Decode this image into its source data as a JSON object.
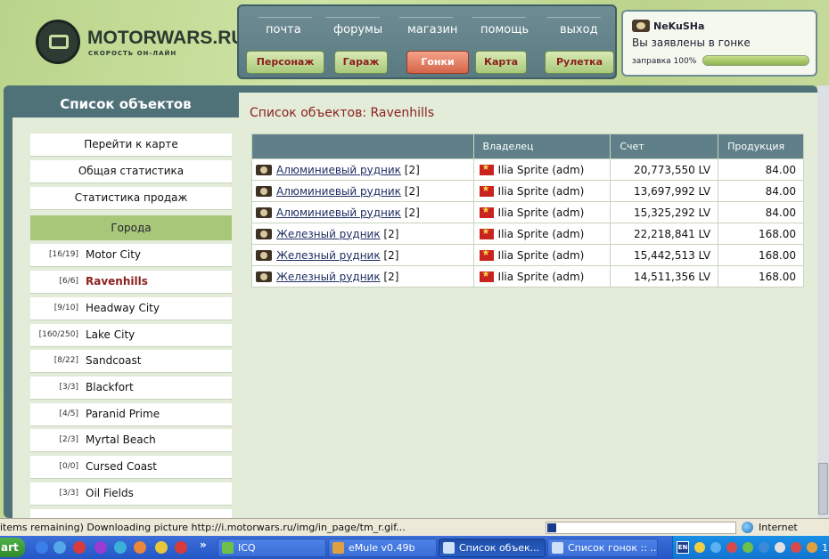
{
  "logo": {
    "name": "MOTORWARS.RU",
    "slogan": "СКОРОСТЬ ОН-ЛАЙН"
  },
  "topnav": {
    "links": [
      "почта",
      "форумы",
      "магазин",
      "помощь",
      "выход"
    ],
    "buttons": [
      "Персонаж",
      "Гараж",
      "Гонки",
      "Карта",
      "Рулетка"
    ],
    "active_button": "Гонки"
  },
  "user": {
    "name": "NeKuSHa",
    "status": "Вы заявлены в гонке",
    "fuel_label": "заправка 100%",
    "fuel_level": 1.0
  },
  "sidebar": {
    "title": "Список объектов",
    "links": [
      "Перейти к карте",
      "Общая статистика",
      "Статистика продаж"
    ],
    "cities_header": "Города",
    "cities": [
      {
        "count": "[16/19]",
        "name": "Motor City"
      },
      {
        "count": "[6/6]",
        "name": "Ravenhills",
        "selected": true
      },
      {
        "count": "[9/10]",
        "name": "Headway City"
      },
      {
        "count": "[160/250]",
        "name": "Lake City"
      },
      {
        "count": "[8/22]",
        "name": "Sandcoast"
      },
      {
        "count": "[3/3]",
        "name": "Blackfort"
      },
      {
        "count": "[4/5]",
        "name": "Paranid Prime"
      },
      {
        "count": "[2/3]",
        "name": "Myrtal Beach"
      },
      {
        "count": "[0/0]",
        "name": "Cursed Coast"
      },
      {
        "count": "[3/3]",
        "name": "Oil Fields"
      }
    ]
  },
  "main": {
    "title": "Список объектов: Ravenhills",
    "columns": [
      "",
      "Владелец",
      "Счет",
      "Продукция"
    ],
    "rows": [
      {
        "object": "Алюминиевый рудник",
        "qty": "[2]",
        "owner": "Ilia Sprite (adm)",
        "account": "20,773,550 LV",
        "product": "84.00"
      },
      {
        "object": "Алюминиевый рудник",
        "qty": "[2]",
        "owner": "Ilia Sprite (adm)",
        "account": "13,697,992 LV",
        "product": "84.00"
      },
      {
        "object": "Алюминиевый рудник",
        "qty": "[2]",
        "owner": "Ilia Sprite (adm)",
        "account": "15,325,292 LV",
        "product": "84.00"
      },
      {
        "object": "Железный рудник",
        "qty": "[2]",
        "owner": "Ilia Sprite (adm)",
        "account": "22,218,841 LV",
        "product": "168.00"
      },
      {
        "object": "Железный рудник",
        "qty": "[2]",
        "owner": "Ilia Sprite (adm)",
        "account": "15,442,513 LV",
        "product": "168.00"
      },
      {
        "object": "Железный рудник",
        "qty": "[2]",
        "owner": "Ilia Sprite (adm)",
        "account": "14,511,356 LV",
        "product": "168.00"
      }
    ]
  },
  "statusbar": {
    "text": "items remaining) Downloading picture http://i.motorwars.ru/img/in_page/tm_r.gif...",
    "zone": "Internet"
  },
  "taskbar": {
    "start": "art",
    "chevron": "»",
    "tasks": [
      {
        "label": "ICQ",
        "active": false
      },
      {
        "label": "eMule v0.49b",
        "active": false
      },
      {
        "label": "Список объек...",
        "active": true
      },
      {
        "label": "Список гонок :: ...",
        "active": false
      }
    ],
    "lang": "EN",
    "clock": "1"
  }
}
